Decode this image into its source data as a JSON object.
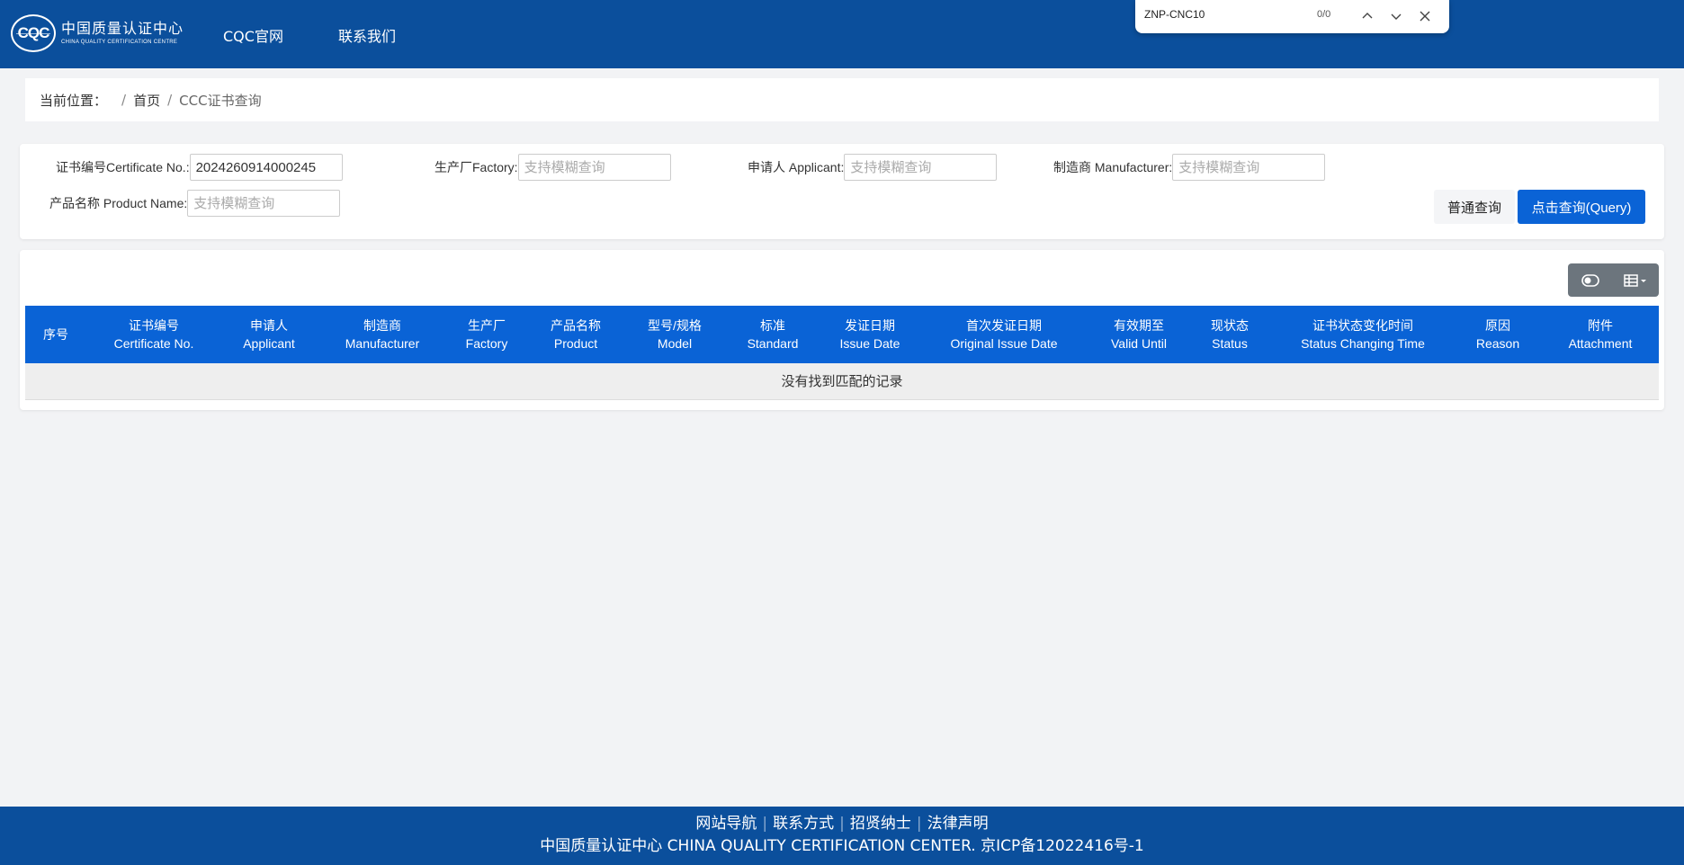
{
  "header": {
    "logo_cn": "中国质量认证中心",
    "logo_en": "CHINA QUALITY CERTIFICATION CENTRE",
    "logo_mark": "CQC",
    "nav": [
      "CQC官网",
      "联系我们"
    ]
  },
  "findbar": {
    "query": "ZNP-CNC10",
    "count": "0/0"
  },
  "breadcrumb": {
    "label": "当前位置：",
    "sep": "/",
    "home": "首页",
    "current": "CCC证书查询"
  },
  "search": {
    "cert_no_label": "证书编号Certificate No.:",
    "cert_no_value": "2024260914000245",
    "factory_label": "生产厂Factory:",
    "factory_placeholder": "支持模糊查询",
    "applicant_label": "申请人 Applicant:",
    "applicant_placeholder": "支持模糊查询",
    "manufacturer_label": "制造商 Manufacturer:",
    "manufacturer_placeholder": "支持模糊查询",
    "product_label": "产品名称 Product Name:",
    "product_placeholder": "支持模糊查询",
    "normal_query": "普通查询",
    "query_button": "点击查询(Query)"
  },
  "table": {
    "columns": [
      {
        "cn": "序号",
        "en": ""
      },
      {
        "cn": "证书编号",
        "en": "Certificate No."
      },
      {
        "cn": "申请人",
        "en": "Applicant"
      },
      {
        "cn": "制造商",
        "en": "Manufacturer"
      },
      {
        "cn": "生产厂",
        "en": "Factory"
      },
      {
        "cn": "产品名称",
        "en": "Product"
      },
      {
        "cn": "型号/规格",
        "en": "Model"
      },
      {
        "cn": "标准",
        "en": "Standard"
      },
      {
        "cn": "发证日期",
        "en": "Issue Date"
      },
      {
        "cn": "首次发证日期",
        "en": "Original Issue Date"
      },
      {
        "cn": "有效期至",
        "en": "Valid Until"
      },
      {
        "cn": "现状态",
        "en": "Status"
      },
      {
        "cn": "证书状态变化时间",
        "en": "Status Changing Time"
      },
      {
        "cn": "原因",
        "en": "Reason"
      },
      {
        "cn": "附件",
        "en": "Attachment"
      }
    ],
    "empty_message": "没有找到匹配的记录"
  },
  "footer": {
    "links": [
      "网站导航",
      "联系方式",
      "招贤纳士",
      "法律声明"
    ],
    "copyright": "中国质量认证中心 CHINA QUALITY CERTIFICATION CENTER.  京ICP备12022416号-1"
  },
  "colors": {
    "header_bg": "#0b4f9c",
    "primary": "#0a63d6",
    "toolbar_bg": "#6c757d"
  }
}
